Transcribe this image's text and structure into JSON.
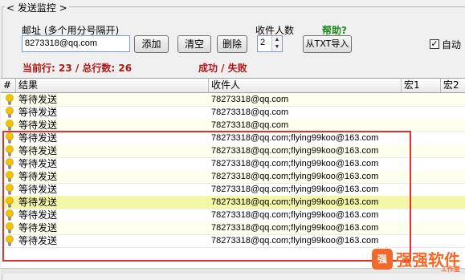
{
  "group": {
    "title": "< 发送监控 >"
  },
  "address": {
    "label": "邮址 (多个用分号隔开)",
    "value": "8273318@qq.com"
  },
  "buttons": {
    "add": "添加",
    "clear": "清空",
    "delete": "删除",
    "import_txt": "从TXT导入"
  },
  "recipients_per": {
    "label": "收件人数",
    "value": "2"
  },
  "help": "帮助?",
  "auto": {
    "label": "自动",
    "checked": true
  },
  "status": {
    "current": "当前行: 23 / 总行数: 26",
    "result": "成功 / 失败"
  },
  "grid": {
    "columns": [
      "#",
      "结果",
      "收件人",
      "宏1",
      "宏2"
    ],
    "rows": [
      {
        "status": "等待发送",
        "recipient": "78273318@qq.com",
        "shade": "odd"
      },
      {
        "status": "等待发送",
        "recipient": "78273318@qq.com",
        "shade": ""
      },
      {
        "status": "等待发送",
        "recipient": "78273318@qq.com",
        "shade": "odd"
      },
      {
        "status": "等待发送",
        "recipient": "78273318@qq.com;flying99koo@163.com",
        "shade": ""
      },
      {
        "status": "等待发送",
        "recipient": "78273318@qq.com;flying99koo@163.com",
        "shade": "odd"
      },
      {
        "status": "等待发送",
        "recipient": "78273318@qq.com;flying99koo@163.com",
        "shade": ""
      },
      {
        "status": "等待发送",
        "recipient": "78273318@qq.com;flying99koo@163.com",
        "shade": "odd"
      },
      {
        "status": "等待发送",
        "recipient": "78273318@qq.com;flying99koo@163.com",
        "shade": ""
      },
      {
        "status": "等待发送",
        "recipient": "78273318@qq.com;flying99koo@163.com",
        "shade": "hi"
      },
      {
        "status": "等待发送",
        "recipient": "78273318@qq.com;flying99koo@163.com",
        "shade": ""
      },
      {
        "status": "等待发送",
        "recipient": "78273318@qq.com;flying99koo@163.com",
        "shade": "odd"
      },
      {
        "status": "等待发送",
        "recipient": "78273318@qq.com;flying99koo@163.com",
        "shade": ""
      }
    ]
  },
  "watermark": {
    "logo": "强",
    "text": "强强软件",
    "sub": "工作室"
  },
  "colors": {
    "bulb": "#f5c400",
    "highlight_box": "#e03030",
    "status_text": "#b01818",
    "help": "#1e8a1e"
  }
}
